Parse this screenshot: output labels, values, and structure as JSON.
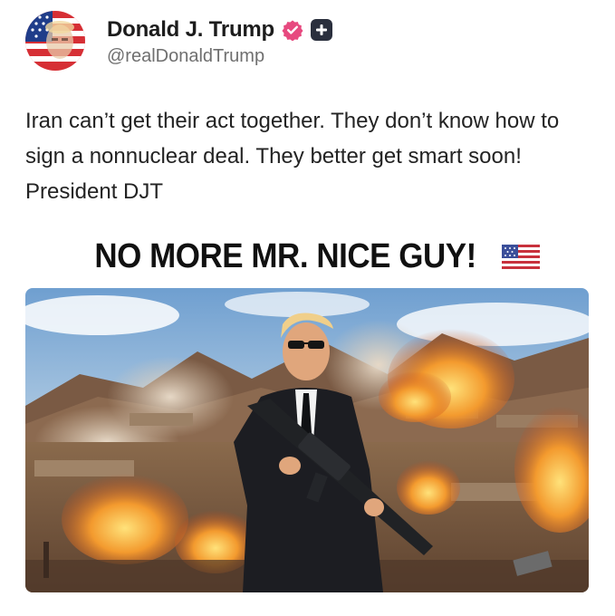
{
  "post": {
    "author": {
      "display_name": "Donald J. Trump",
      "handle": "@realDonaldTrump",
      "verified_icon": "verified-badge-icon",
      "follow_icon": "plus-icon",
      "avatar_icon": "avatar-flag-portrait"
    },
    "text": "Iran can’t get their act together. They don’t know how to sign a nonnuclear deal. They better get smart soon! President DJT",
    "image": {
      "caption": "NO MORE MR. NICE GUY!",
      "caption_emoji": "us-flag-emoji"
    }
  },
  "colors": {
    "verified_badge": "#e7497f",
    "follow_button": "#2a2f3d",
    "handle_text": "#6f6f6f"
  }
}
